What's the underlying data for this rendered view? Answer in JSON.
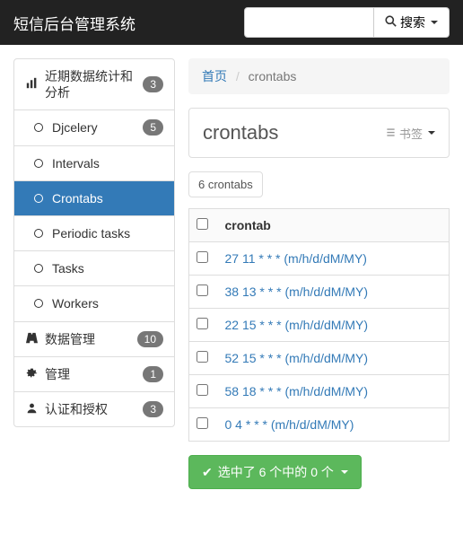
{
  "navbar": {
    "brand": "短信后台管理系统",
    "search_placeholder": "",
    "search_btn": "搜索"
  },
  "sidebar": [
    {
      "icon": "bar",
      "label": "近期数据统计和分析",
      "badge": "3",
      "head": true
    },
    {
      "icon": "circle",
      "label": "Djcelery",
      "badge": "5",
      "sub": true
    },
    {
      "icon": "circle",
      "label": "Intervals",
      "sub": true
    },
    {
      "icon": "circle",
      "label": "Crontabs",
      "sub": true,
      "active": true
    },
    {
      "icon": "circle",
      "label": "Periodic tasks",
      "sub": true
    },
    {
      "icon": "circle",
      "label": "Tasks",
      "sub": true
    },
    {
      "icon": "circle",
      "label": "Workers",
      "sub": true
    },
    {
      "icon": "road",
      "label": "数据管理",
      "badge": "10",
      "head": true
    },
    {
      "icon": "gear",
      "label": "管理",
      "badge": "1",
      "head": true
    },
    {
      "icon": "user",
      "label": "认证和授权",
      "badge": "3",
      "head": true
    }
  ],
  "breadcrumb": {
    "home": "首页",
    "current": "crontabs"
  },
  "page": {
    "title": "crontabs",
    "bookmark": "书签",
    "count": "6 crontabs",
    "col_header": "crontab"
  },
  "rows": [
    "27 11 * * * (m/h/d/dM/MY)",
    "38 13 * * * (m/h/d/dM/MY)",
    "22 15 * * * (m/h/d/dM/MY)",
    "52 15 * * * (m/h/d/dM/MY)",
    "58 18 * * * (m/h/d/dM/MY)",
    "0 4 * * * (m/h/d/dM/MY)"
  ],
  "selection": "选中了 6 个中的 0 个"
}
